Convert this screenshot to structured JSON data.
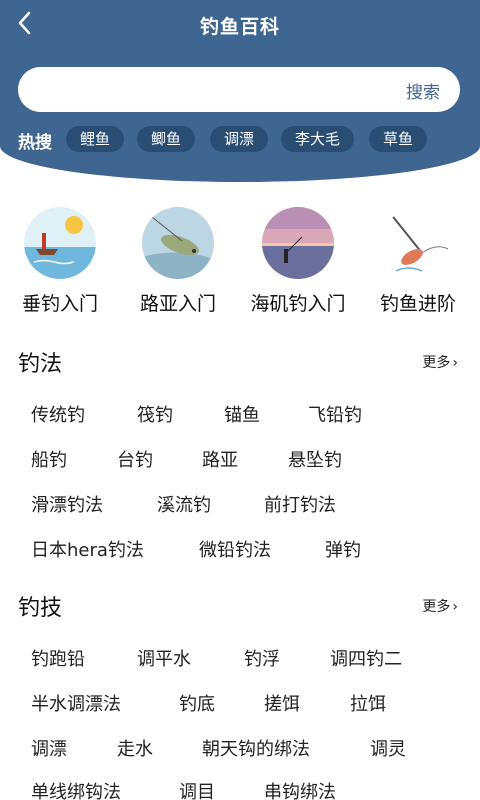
{
  "header": {
    "title": "钓鱼百科",
    "back_icon": "chevron-left-icon",
    "background": "#3e6690"
  },
  "search": {
    "value": "",
    "placeholder": "",
    "button_label": "搜索"
  },
  "hot": {
    "label": "热搜",
    "tags": [
      "鲤鱼",
      "鲫鱼",
      "调漂",
      "李大毛",
      "草鱼"
    ]
  },
  "categories": [
    {
      "label": "垂钓入门",
      "image": "fishing-boat-sunset"
    },
    {
      "label": "路亚入门",
      "image": "lure-fish"
    },
    {
      "label": "海矶钓入门",
      "image": "sea-angler-sunset"
    },
    {
      "label": "钓鱼进阶",
      "image": "rod-fish-sketch"
    }
  ],
  "sections": [
    {
      "title": "钓法",
      "more_label": "更多",
      "rows": [
        [
          "传统钓",
          "筏钓",
          "锚鱼",
          "飞铅钓"
        ],
        [
          "船钓",
          "台钓",
          "路亚",
          "悬坠钓"
        ],
        [
          "滑漂钓法",
          "溪流钓",
          "前打钓法"
        ],
        [
          "日本hera钓法",
          "微铅钓法",
          "弹钓"
        ]
      ]
    },
    {
      "title": "钓技",
      "more_label": "更多",
      "rows": [
        [
          "钓跑铅",
          "调平水",
          "钓浮",
          "调四钓二"
        ],
        [
          "半水调漂法",
          "钓底",
          "搓饵",
          "拉饵"
        ],
        [
          "调漂",
          "走水",
          "朝天钩的绑法",
          "调灵"
        ],
        [
          "单线绑钩法",
          "调目",
          "串钩绑法"
        ]
      ]
    }
  ]
}
